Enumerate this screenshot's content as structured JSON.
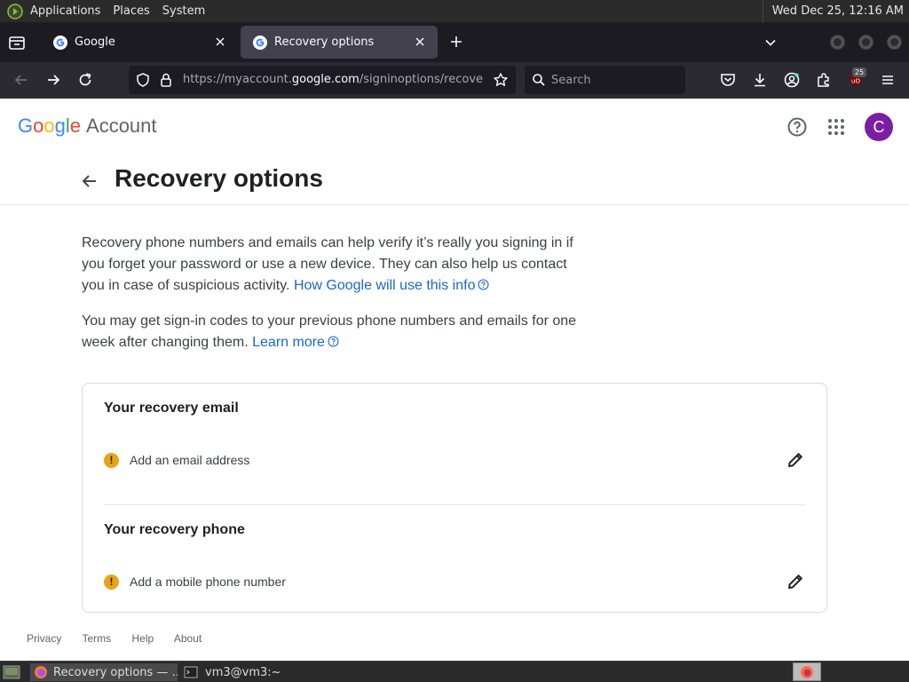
{
  "os_panel": {
    "menus": [
      "Applications",
      "Places",
      "System"
    ],
    "clock": "Wed Dec 25, 12:16 AM"
  },
  "browser": {
    "tabs": [
      {
        "title": "Google",
        "active": false
      },
      {
        "title": "Recovery options",
        "active": true
      }
    ],
    "url": {
      "prefix": "https://myaccount.",
      "domain": "google.com",
      "path": "/signinoptions/recovery"
    },
    "search_placeholder": "Search",
    "extension_badge": "25"
  },
  "page": {
    "brand": {
      "google": [
        "G",
        "o",
        "o",
        "g",
        "l",
        "e"
      ],
      "account": "Account"
    },
    "avatar_initial": "C",
    "title": "Recovery options",
    "intro": {
      "text": "Recovery phone numbers and emails can help verify it’s really you signing in if you forget your password or use a new device. They can also help us con­tact you in case of suspicious activity.",
      "link": "How Google will use this info"
    },
    "notice": {
      "text": "You may get sign-in codes to your previous phone numbers and emails for one week after changing them.",
      "link": "Learn more"
    },
    "email_section": {
      "title": "Your recovery email",
      "action": "Add an email address"
    },
    "phone_section": {
      "title": "Your recovery phone",
      "action": "Add a mobile phone number"
    },
    "footer": [
      "Privacy",
      "Terms",
      "Help",
      "About"
    ]
  },
  "taskbar": {
    "items": [
      "Recovery options — …",
      "vm3@vm3:~"
    ]
  },
  "colors": {
    "google_blue": "#4285F4",
    "google_red": "#EA4335",
    "google_yellow": "#FBBC05",
    "google_green": "#34A853",
    "link": "#1a66d2",
    "avatar": "#7b1fa2",
    "warning": "#e8a317"
  }
}
